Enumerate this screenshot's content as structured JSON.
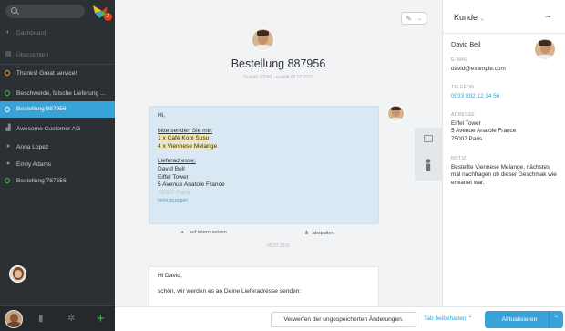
{
  "sidebar": {
    "nav": [
      {
        "label": "Dashboard",
        "icon": "dashboard-icon",
        "kind": "dim"
      },
      {
        "label": "Übersichten",
        "icon": "overviews-icon",
        "kind": "dim"
      },
      {
        "label": "Thanks! Great service!",
        "icon": "status-dot-icon",
        "dot": "#f0a32c"
      },
      {
        "label": "Beschwerde, falsche Lieferung ...",
        "icon": "status-dot-icon",
        "dot": "#45c34f"
      },
      {
        "label": "Bestellung 887956",
        "icon": "status-dot-icon",
        "dot": "#ffffff",
        "active": true
      },
      {
        "label": "Awesome Customer AG",
        "icon": "organization-icon"
      },
      {
        "label": "Anna Lopez",
        "icon": "person-icon"
      },
      {
        "label": "Emily Adams",
        "icon": "person-icon"
      },
      {
        "label": "Bestellung 787556",
        "icon": "status-dot-icon",
        "dot": "#45c34f"
      }
    ],
    "logo_badge": "2",
    "bottom_icons": [
      "user-avatar",
      "stats-icon",
      "settings-icon",
      "plus-icon"
    ]
  },
  "ticket": {
    "title": "Bestellung 887956",
    "subtitle": "Ticket# 10000 - erstellt 05.07.2016",
    "article1": {
      "greeting": "Hi,",
      "intro": "bitte senden Sie mir:",
      "item1": "1 x Café Kopi Susu",
      "item2": "4 x Viennese Melange",
      "address_heading": "Lieferadresse:",
      "address_name": "David Bell",
      "address_line1": "Eiffel Tower",
      "address_line2": "5 Avenue Anatole France",
      "address_line3": "75007 Paris",
      "more": "mehr anzeigen"
    },
    "action_internal": "auf intern setzen",
    "action_split": "abspalten",
    "date_separator": "05.07.2016",
    "article2": {
      "greeting": "Hi David,",
      "body": "schön, wir werden es an Deine Lieferadresse senden:"
    }
  },
  "customer": {
    "panel_title": "Kunde",
    "name": "David Bell",
    "email_label": "E-MAIL",
    "email": "david@example.com",
    "phone_label": "TELEFON",
    "phone": "0033 892 12 34 56",
    "address_label": "ADRESSE",
    "address": [
      "Eiffel Tower",
      "5 Avenue Anatole France",
      "75007 Paris"
    ],
    "note_label": "NOTIZ",
    "note": "Bestellte Viennese Melange, nächstes mal nachfragen ob dieser Geschmak wie erwartet war."
  },
  "footer": {
    "discard": "Verwerfen der ungespeicherten Änderungen.",
    "keep_tab": "Tab beibehalten",
    "update": "Aktualisieren"
  },
  "colors": {
    "accent": "#38a3d9",
    "sidebar_bg": "#2b3034",
    "success": "#45c34f",
    "warning": "#f0a32c"
  }
}
